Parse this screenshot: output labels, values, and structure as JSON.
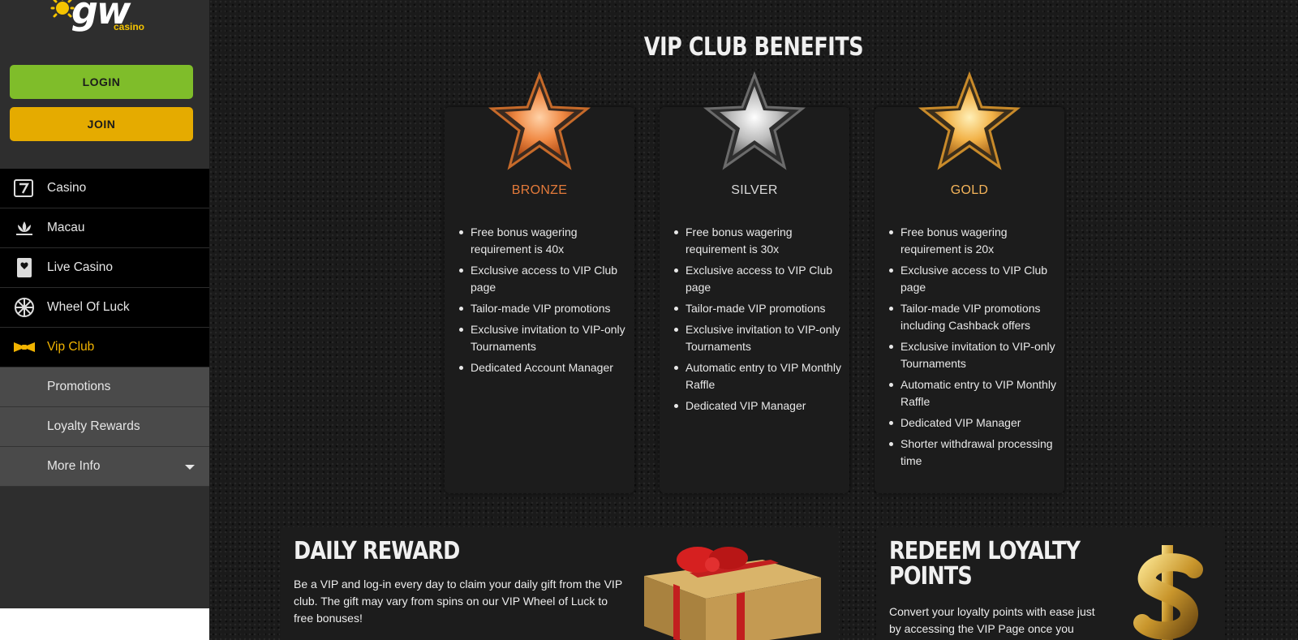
{
  "brand": {
    "logo_main": "gw",
    "logo_sub": "casino"
  },
  "auth": {
    "login_label": "LOGIN",
    "join_label": "JOIN"
  },
  "nav": {
    "items": [
      {
        "label": "Casino",
        "icon": "slot-seven-icon"
      },
      {
        "label": "Macau",
        "icon": "lotus-icon"
      },
      {
        "label": "Live Casino",
        "icon": "playing-card-icon"
      },
      {
        "label": "Wheel Of Luck",
        "icon": "wheel-icon"
      },
      {
        "label": "Vip Club",
        "icon": "bow-tie-icon",
        "active": true
      }
    ],
    "sub_items": [
      {
        "label": "Promotions"
      },
      {
        "label": "Loyalty Rewards"
      },
      {
        "label": "More Info",
        "has_dropdown": true
      }
    ]
  },
  "page": {
    "title": "VIP CLUB BENEFITS"
  },
  "tiers": [
    {
      "name": "BRONZE",
      "color": "#e37a3a",
      "star": "bronze-star-icon",
      "benefits": [
        "Free bonus wagering requirement is 40x",
        "Exclusive access to VIP Club page",
        "Tailor-made VIP promotions",
        "Exclusive invitation to VIP-only Tournaments",
        "Dedicated Account Manager"
      ]
    },
    {
      "name": "SILVER",
      "color": "#d8d8d8",
      "star": "silver-star-icon",
      "benefits": [
        "Free bonus wagering requirement is 30x",
        "Exclusive access to VIP Club page",
        "Tailor-made VIP promotions",
        "Exclusive invitation to VIP-only Tournaments",
        "Automatic entry to VIP Monthly Raffle",
        "Dedicated VIP Manager"
      ]
    },
    {
      "name": "GOLD",
      "color": "#f4b45a",
      "star": "gold-star-icon",
      "benefits": [
        "Free bonus wagering requirement is 20x",
        "Exclusive access to VIP Club page",
        "Tailor-made VIP promotions including Cashback offers",
        "Exclusive invitation to VIP-only Tournaments",
        "Automatic entry to VIP Monthly Raffle",
        "Dedicated VIP Manager",
        "Shorter withdrawal processing time"
      ]
    }
  ],
  "daily_reward": {
    "title": "DAILY REWARD",
    "text": "Be a VIP and log-in every day to claim your daily gift from the VIP club. The gift may vary from spins on our VIP Wheel of Luck to free bonuses!",
    "image": "gift-box-icon"
  },
  "redeem": {
    "title": "REDEEM LOYALTY POINTS",
    "text": "Convert your loyalty points with ease just by accessing the VIP Page once you become",
    "image": "dollar-sign-icon"
  }
}
